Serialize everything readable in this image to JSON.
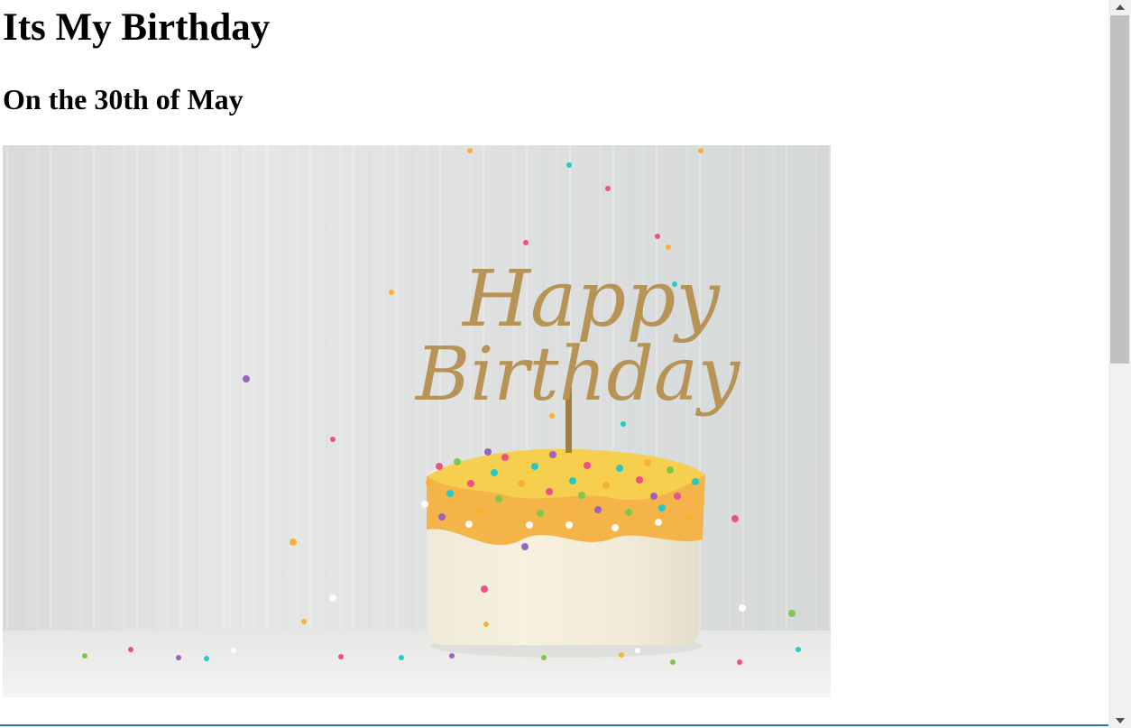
{
  "page": {
    "heading": "Its My Birthday",
    "subheading": "On the 30th of May"
  },
  "image": {
    "topper_line_1": "Happy",
    "topper_line_2": "Birthday",
    "alt": "Happy Birthday"
  },
  "scrollbar": {
    "up_icon": "scroll-up-arrow-icon",
    "down_icon": "scroll-down-arrow-icon"
  },
  "colors": {
    "accent_line": "#2378a8",
    "scrollbar_track": "#f1f1f1",
    "scrollbar_thumb": "#c1c1c1"
  }
}
